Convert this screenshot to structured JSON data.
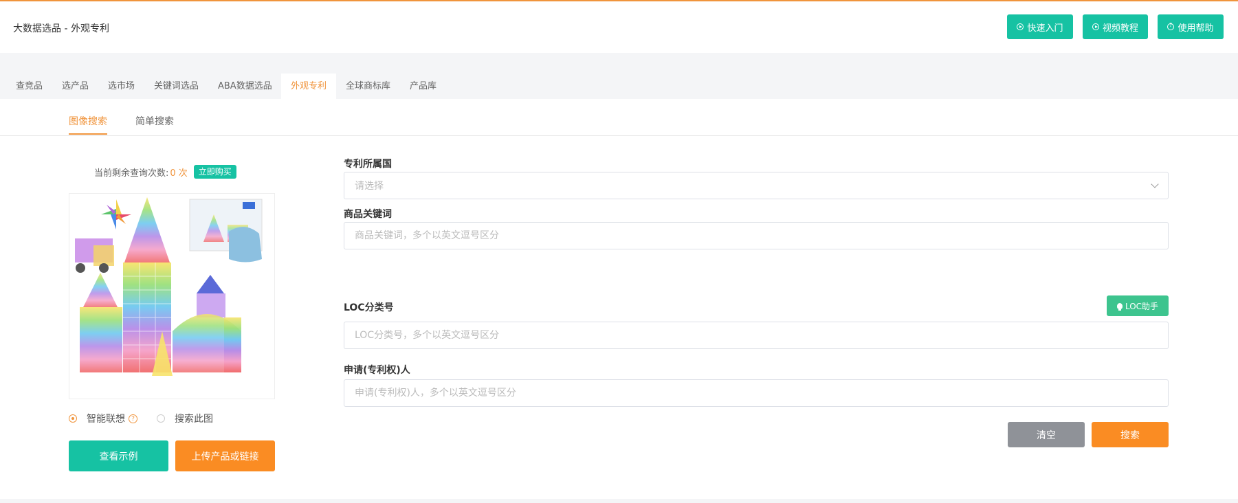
{
  "header": {
    "title": "大数据选品 - 外观专利",
    "buttons": [
      {
        "label": "快速入门",
        "icon": "play-circle-icon"
      },
      {
        "label": "视频教程",
        "icon": "play-circle-icon"
      },
      {
        "label": "使用帮助",
        "icon": "question-circle-icon"
      }
    ]
  },
  "tabs": [
    "查竞品",
    "选产品",
    "选市场",
    "关键词选品",
    "ABA数据选品",
    "外观专利",
    "全球商标库",
    "产品库"
  ],
  "active_tab": "外观专利",
  "subtabs": [
    "图像搜索",
    "简单搜索"
  ],
  "active_subtab": "图像搜索",
  "quota": {
    "label": "当前剩余查询次数:",
    "count": "0 次",
    "buy_label": "立即购买"
  },
  "image_options": {
    "smart": "智能联想",
    "help": "?",
    "search_this": "搜索此图",
    "selected": "智能联想"
  },
  "left_buttons": {
    "example": "查看示例",
    "upload": "上传产品或链接"
  },
  "form": {
    "country_label": "专利所属国",
    "country_placeholder": "请选择",
    "keyword_label": "商品关键词",
    "keyword_placeholder": "商品关键词，多个以英文逗号区分",
    "loc_label": "LOC分类号",
    "loc_helper": "LOC助手",
    "loc_placeholder": "LOC分类号，多个以英文逗号区分",
    "applicant_label": "申请(专利权)人",
    "applicant_placeholder": "申请(专利权)人，多个以英文逗号区分",
    "clear": "清空",
    "search": "搜索"
  },
  "colors": {
    "accent": "#f0943c",
    "teal": "#16c2a3",
    "green": "#3dc48e",
    "gray_button": "#8f9298",
    "orange_button": "#fa8c23"
  }
}
